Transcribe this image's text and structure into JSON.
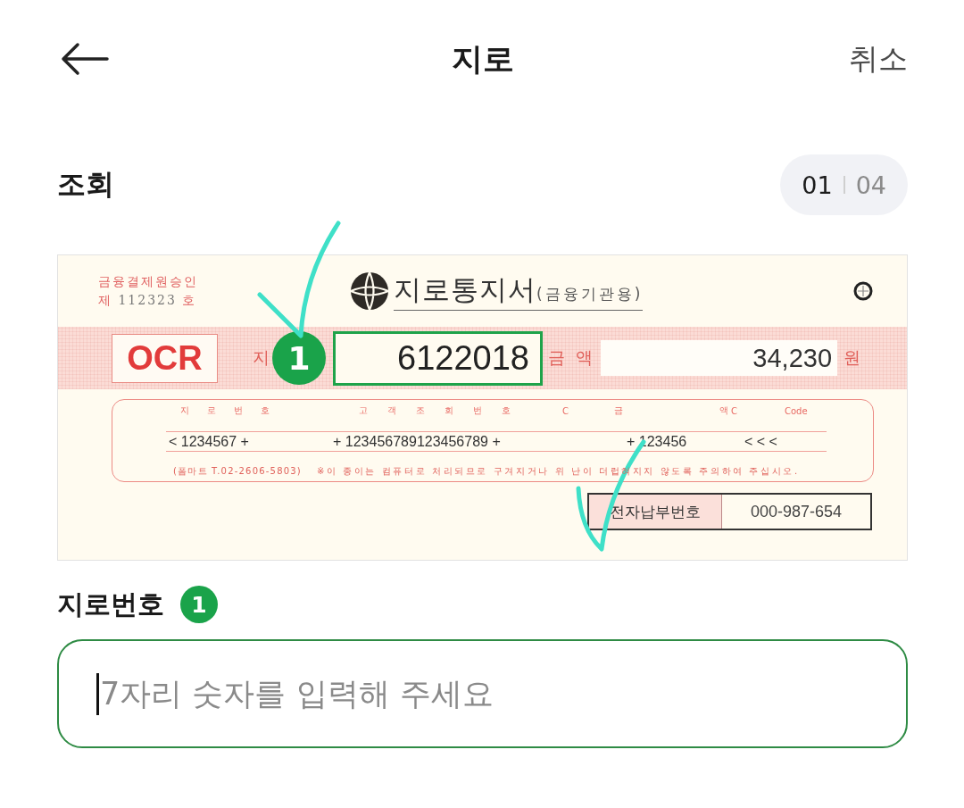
{
  "header": {
    "title": "지로",
    "cancel": "취소"
  },
  "section": {
    "title": "조회",
    "pager": {
      "current": "01",
      "total": "04"
    }
  },
  "giro_slip": {
    "approval": {
      "line": "금융결제원승인",
      "prefix": "제",
      "number": "112323",
      "suffix": "호"
    },
    "title": "지로통지서",
    "subtitle": "(금융기관용)",
    "ocr_label": "OCR",
    "giro_label": "지",
    "giro_badge": "1",
    "giro_number": "6122018",
    "amount_label": "금 액",
    "amount": "34,230",
    "currency": "원",
    "code_headings": [
      "지 로 번 호",
      "고 객 조 회 번 호",
      "C",
      "금 액",
      "C",
      "Code"
    ],
    "code_line": [
      "< 1234567 +",
      "+ 123456789123456789 +",
      "+ 123456",
      "< < <"
    ],
    "contact": "(폼마트 T.02-2606-5803)",
    "notice": "※이 종이는 컴퓨터로 처리되므로 구겨지거나 위 난이 더럽혀지지 않도록 주의하여 주십시오.",
    "payment_label": "전자납부번호",
    "payment_number": "000-987-654"
  },
  "giro_field": {
    "label": "지로번호",
    "badge": "1",
    "placeholder": "7자리 숫자를 입력해 주세요",
    "focused": true
  }
}
